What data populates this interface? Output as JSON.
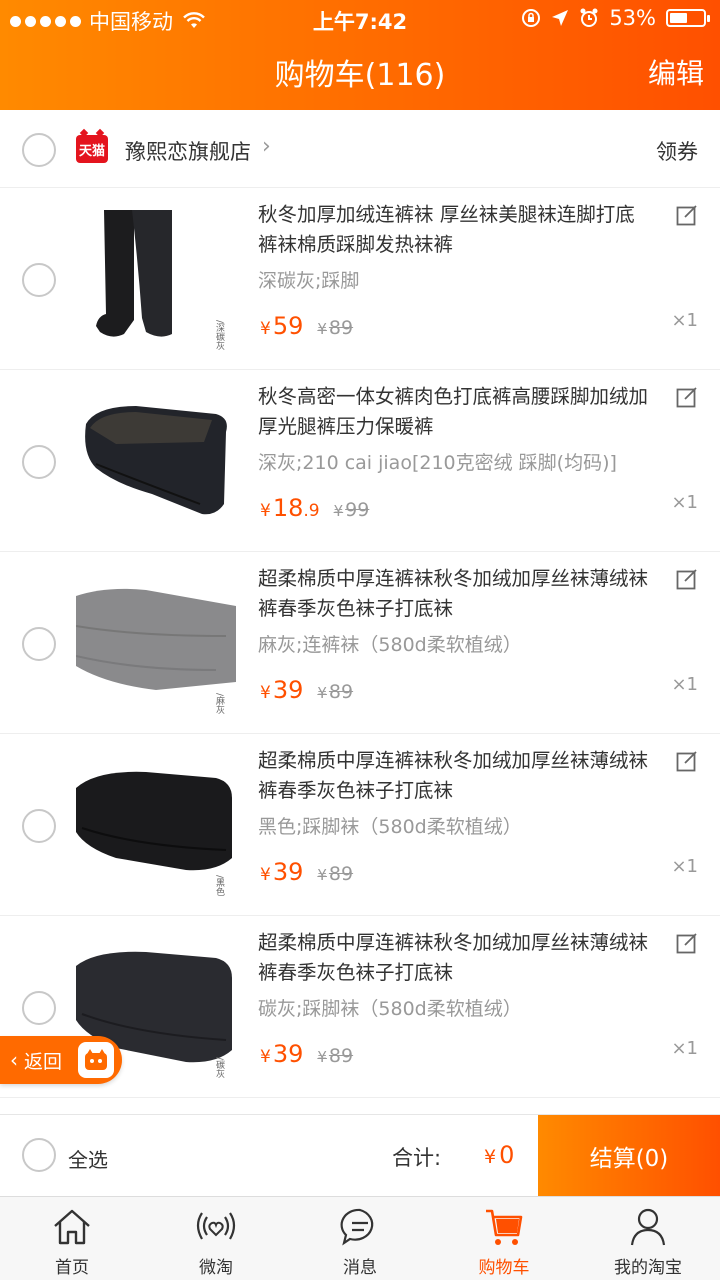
{
  "status_bar": {
    "carrier": "中国移动",
    "time": "上午7:42",
    "battery": "53%",
    "battery_level": 0.53
  },
  "header": {
    "title": "购物车(116)",
    "edit_label": "编辑"
  },
  "store": {
    "badge": "天猫",
    "name": "豫熙恋旗舰店",
    "coupon_label": "领券"
  },
  "items": [
    {
      "title": "秋冬加厚加绒连裤袜 厚丝袜美腿袜连脚打底裤袜棉质踩脚发热袜裤",
      "sku": "深碳灰;踩脚",
      "price_int": "59",
      "price_dec": "",
      "original": "89",
      "qty": "×1",
      "thumb_caption": "/深碳灰",
      "thumb_color": "#1c1c1e"
    },
    {
      "title": "秋冬高密一体女裤肉色打底裤高腰踩脚加绒加厚光腿裤压力保暖裤",
      "sku": "深灰;210 cai jiao[210克密绒 踩脚(均码)]",
      "price_int": "18",
      "price_dec": ".9",
      "original": "99",
      "qty": "×1",
      "thumb_caption": "",
      "thumb_color": "#22242a"
    },
    {
      "title": "超柔棉质中厚连裤袜秋冬加绒加厚丝袜薄绒袜裤春季灰色袜子打底袜",
      "sku": "麻灰;连裤袜（580d柔软植绒）",
      "price_int": "39",
      "price_dec": "",
      "original": "89",
      "qty": "×1",
      "thumb_caption": "/麻灰",
      "thumb_color": "#8a8a8c"
    },
    {
      "title": "超柔棉质中厚连裤袜秋冬加绒加厚丝袜薄绒袜裤春季灰色袜子打底袜",
      "sku": "黑色;踩脚袜（580d柔软植绒）",
      "price_int": "39",
      "price_dec": "",
      "original": "89",
      "qty": "×1",
      "thumb_caption": "/黑色",
      "thumb_color": "#1a1a1c"
    },
    {
      "title": "超柔棉质中厚连裤袜秋冬加绒加厚丝袜薄绒袜裤春季灰色袜子打底袜",
      "sku": "碳灰;踩脚袜（580d柔软植绒）",
      "price_int": "39",
      "price_dec": "",
      "original": "89",
      "qty": "×1",
      "thumb_caption": "/碳灰",
      "thumb_color": "#2a2b30"
    }
  ],
  "back_button": {
    "label": "返回"
  },
  "checkout": {
    "select_all": "全选",
    "total_label": "合计:",
    "total_value": "0",
    "settle_label": "结算(0)"
  },
  "currency_symbol": "¥",
  "tabs": [
    {
      "label": "首页",
      "icon": "home-icon"
    },
    {
      "label": "微淘",
      "icon": "weitao-icon"
    },
    {
      "label": "消息",
      "icon": "message-icon"
    },
    {
      "label": "购物车",
      "icon": "cart-icon"
    },
    {
      "label": "我的淘宝",
      "icon": "profile-icon"
    }
  ],
  "colors": {
    "brand_orange": "#ff5000",
    "header_gradient_start": "#ff8a00"
  }
}
